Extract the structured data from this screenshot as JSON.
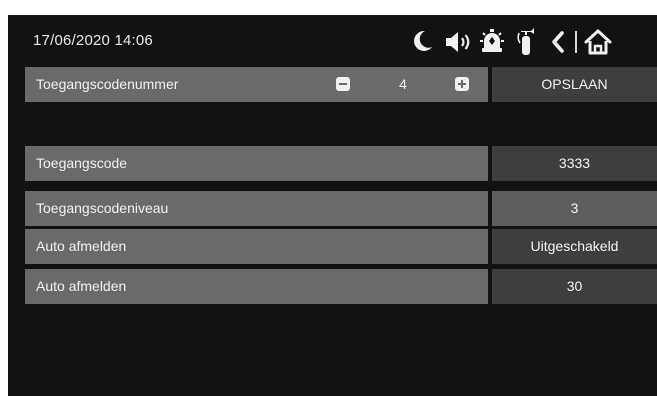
{
  "header": {
    "datetime": "17/06/2020  14:06",
    "icons": [
      "moon-icon",
      "speaker-icon",
      "alarm-icon",
      "extinguisher-icon",
      "back-icon",
      "home-icon"
    ]
  },
  "code_number": {
    "label": "Toegangscodenummer",
    "value": "4",
    "save_label": "OPSLAAN"
  },
  "rows": [
    {
      "label": "Toegangscode",
      "value": "3333"
    },
    {
      "label": "Toegangscodeniveau",
      "value": "3"
    },
    {
      "label": "Auto afmelden",
      "value": "Uitgeschakeld"
    },
    {
      "label": "Auto afmelden",
      "value": "30"
    }
  ],
  "colors": {
    "background": "#111214",
    "label_cell": "#6a6a6a",
    "value_cell_dark": "#3d3e40",
    "value_cell_mid": "#5e5e5e",
    "text": "#f1f1f1"
  }
}
